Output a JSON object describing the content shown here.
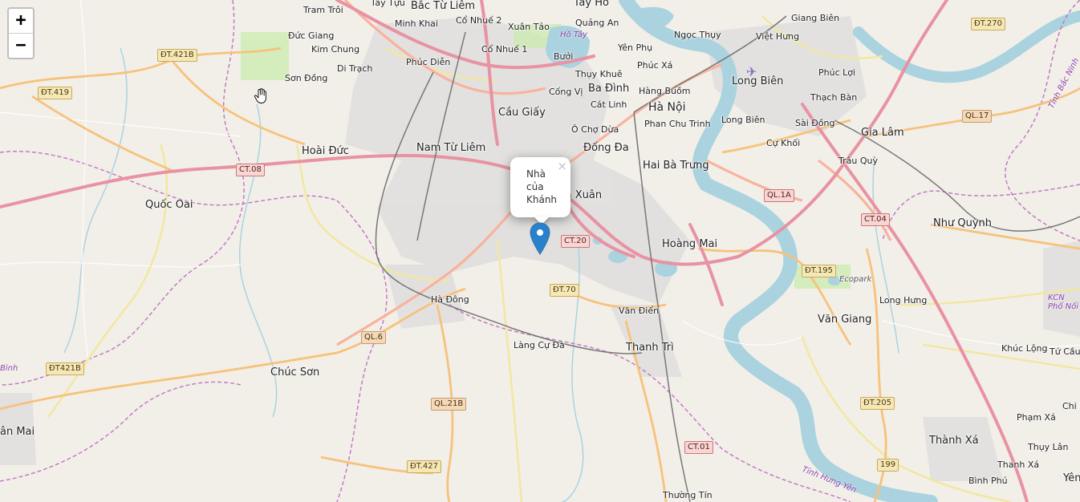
{
  "zoom": {
    "in_label": "+",
    "out_label": "−"
  },
  "popup": {
    "text_lines": [
      "Nhà",
      "của",
      "Khánh"
    ],
    "close_label": "×"
  },
  "places": {
    "tram_troi": "Tram Trôi",
    "tay_tuu": "Tây Tựu",
    "bac_tu_liem": "Bắc Từ Liêm",
    "tay_ho": "Tây Hồ",
    "giang_bien": "Giang Biên",
    "dt270": "ĐT.270",
    "co_nhue_2": "Cổ Nhuế 2",
    "minh_khai": "Minh Khai",
    "xuan_tao": "Xuân Tảo",
    "quang_an": "Quảng An",
    "ho_tay": "Hồ Tây",
    "duc_giang": "Đức Giang",
    "ngoc_thuy": "Ngọc Thụy",
    "viet_hung": "Việt Hưng",
    "dt421b": "ĐT.421B",
    "kim_chung": "Kim Chung",
    "co_nhue_1": "Cổ Nhuế 1",
    "yen_phu": "Yên Phụ",
    "phuc_dien": "Phúc Diễn",
    "buoi": "Bưởi",
    "phuc_xa": "Phúc Xá",
    "di_trach": "Di Trạch",
    "thuy_khue": "Thụy Khuê",
    "long_bien_big": "Long Biên",
    "phuc_loi": "Phúc Lợi",
    "son_dong": "Sơn Đồng",
    "ba_dinh": "Ba Đình",
    "dt419": "ĐT.419",
    "cong_vi": "Cống Vị",
    "hang_buom": "Hàng Buồm",
    "thach_ban": "Thạch Bàn",
    "cat_linh": "Cát Linh",
    "ha_noi": "Hà Nội",
    "cau_giay": "Cầu Giấy",
    "ql17": "QL.17",
    "long_bien": "Long Biên",
    "sai_dong": "Sài Đồng",
    "phan_chu_trinh": "Phan Chu Trinh",
    "o_cho_dua": "Ô Chợ Dừa",
    "gia_lam": "Gia Lâm",
    "cu_khoi": "Cự Khối",
    "nam_tu_liem": "Nam Từ Liêm",
    "dong_da": "Đống Đa",
    "hoai_duc": "Hoài Đức",
    "ct08": "CT.08",
    "trau_quy": "Trâu Quỳ",
    "hai_ba_trung": "Hai Bà Trưng",
    "thanh_xuan": "Thanh Xuân",
    "ql1a": "QL.1A",
    "quoc_oai": "Quốc Oai",
    "ct04": "CT.04",
    "nhu_quynh": "Như Quỳnh",
    "ct20": "CT.20",
    "hoang_mai": "Hoàng Mai",
    "dt195": "ĐT.195",
    "ecopark": "Ecopark",
    "dt70": "ĐT.70",
    "ha_dong": "Hà Đông",
    "kcn_pho_noi": "KCN Phố Nối",
    "long_hung": "Long Hưng",
    "van_dien": "Văn Điển",
    "van_giang": "Văn Giang",
    "ql6": "QL.6",
    "lang_cu_da": "Làng Cự Đà",
    "thanh_tri": "Thanh Trì",
    "khuc_long": "Khúc Lộng",
    "tu_cau": "Tứ Cầu",
    "dt421b_2": "ĐT421B",
    "chuc_son": "Chúc Sơn",
    "ql21b": "QL.21B",
    "dt205": "ĐT.205",
    "chi_le": "Chi Lê",
    "yen_mai": "ân Mai",
    "pham_xa": "Phạm Xá",
    "thanh_xa": "Thành Xá",
    "thuy_lan": "Thụy Lân",
    "ct01": "CT.01",
    "dt427": "ĐT.427",
    "r199": "199",
    "thanh_xa_small": "Thanh Xá",
    "binh_phu": "Bình Phú",
    "yen": "Yên",
    "thuong_tin": "Thường Tín",
    "tinh_bac_ninh": "Tỉnh Bắc Ninh",
    "tinh_hung_yen": "Tỉnh Hưng Yên",
    "binh": "Bình"
  },
  "colors": {
    "land": "#f2efe9",
    "water": "#aad3df",
    "motorway": "#e892a2",
    "trunk": "#f9b29c",
    "primary": "#fcd6a4",
    "boundary": "#ac46ac",
    "urban": "#dddddd",
    "marker": "#2a81cb"
  }
}
